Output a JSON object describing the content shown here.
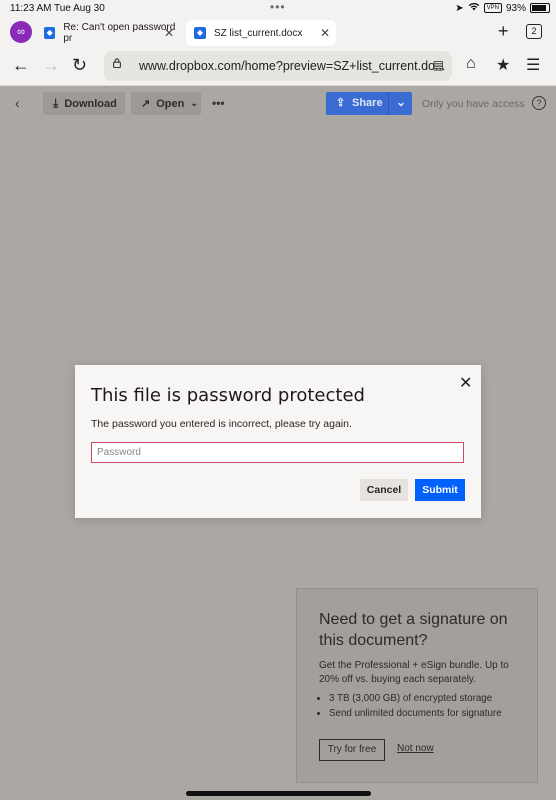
{
  "status_bar": {
    "time": "11:23 AM",
    "date": "Tue Aug 30",
    "vpn_label": "VPN",
    "battery": "93%"
  },
  "browser": {
    "profile_icon": "infinity-icon",
    "tabs": [
      {
        "title": "Re: Can't open password pr",
        "active": false
      },
      {
        "title": "SZ list_current.docx",
        "active": true
      }
    ],
    "tab_count": "2",
    "url": "www.dropbox.com/home?preview=SZ+list_current.do..."
  },
  "toolbar": {
    "download_label": "Download",
    "open_label": "Open",
    "share_label": "Share",
    "access_text": "Only you have access",
    "help_label": "?"
  },
  "dialog": {
    "title": "This file is password protected",
    "message": "The password you entered is incorrect, please try again.",
    "password_placeholder": "Password",
    "cancel_label": "Cancel",
    "submit_label": "Submit"
  },
  "promo": {
    "heading": "Need to get a signature on this document?",
    "description": "Get the Professional + eSign bundle. Up to 20% off vs. buying each separately.",
    "bullets": [
      "3 TB (3,000 GB) of encrypted storage",
      "Send unlimited documents for signature"
    ],
    "try_label": "Try for free",
    "not_now_label": "Not now"
  },
  "colors": {
    "accent": "#0061fe",
    "share": "#3a6bd3",
    "error_border": "#c54b68",
    "overlay": "#aba7a3"
  }
}
